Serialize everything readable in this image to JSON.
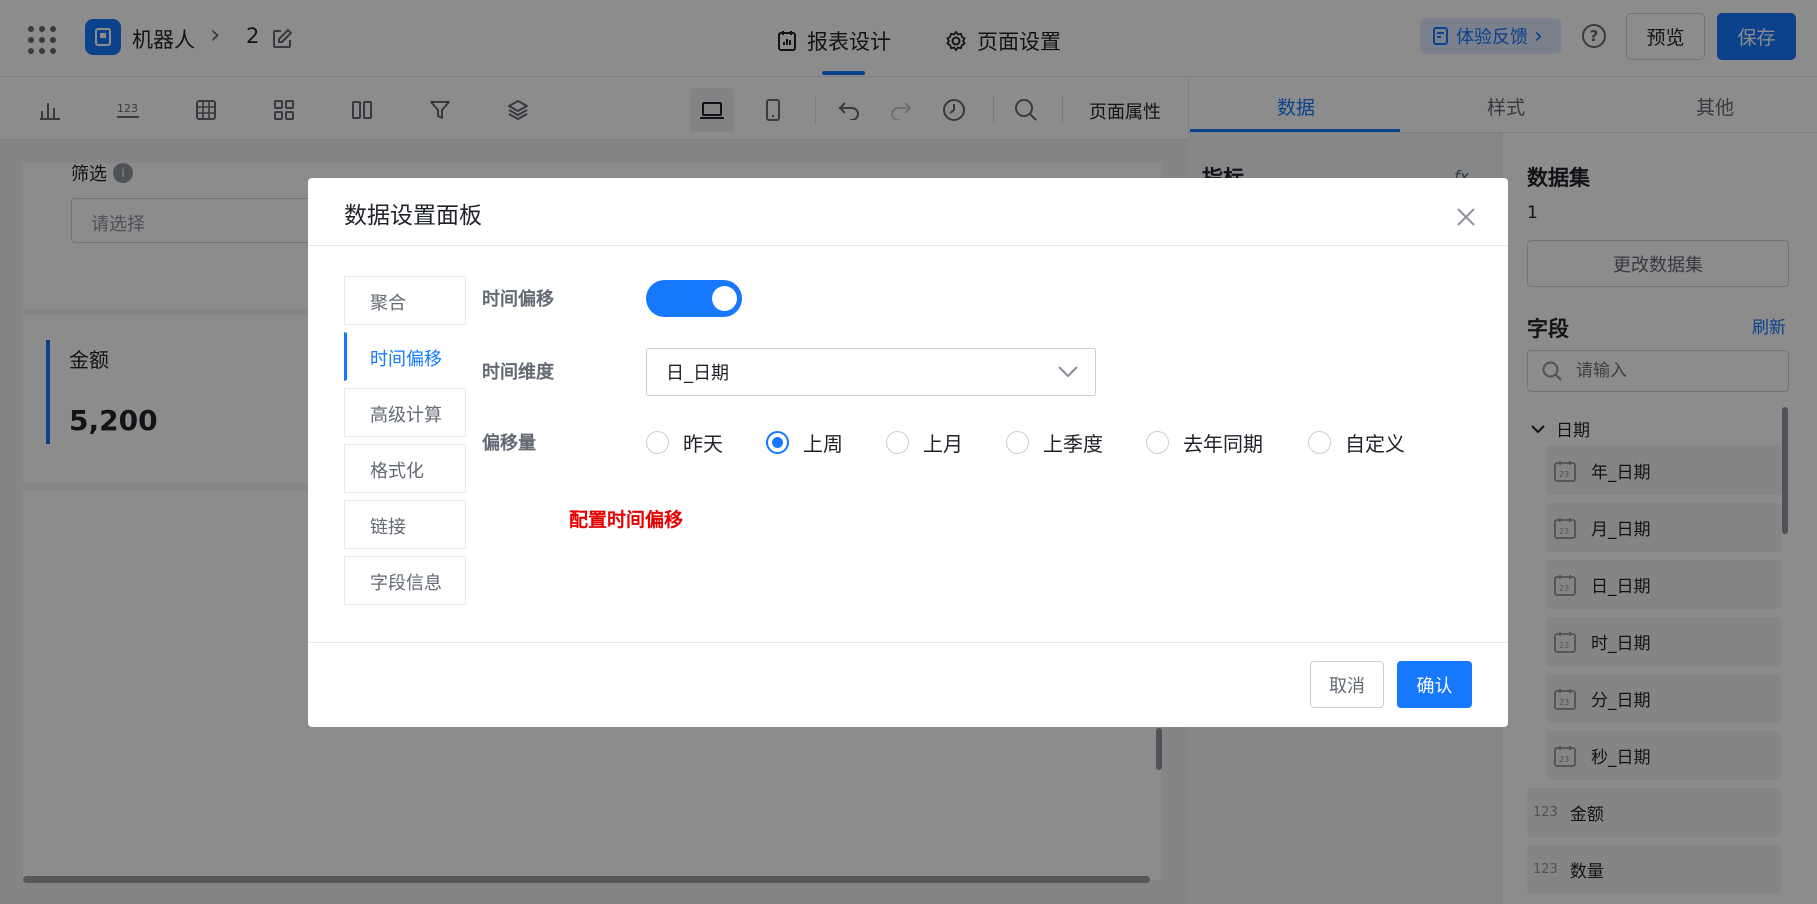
{
  "header": {
    "app_name": "机器人",
    "sep": "›",
    "doc_name": "2",
    "tabs": [
      {
        "label": "报表设计"
      },
      {
        "label": "页面设置"
      }
    ],
    "feedback": "体验反馈",
    "feedback_chevron": "›",
    "help_glyph": "?",
    "preview": "预览",
    "save": "保存"
  },
  "toolbar": {
    "page_props": "页面属性"
  },
  "canvas": {
    "filter_label": "筛选",
    "info_glyph": "i",
    "filter_placeholder": "请选择",
    "metric_title": "金额",
    "metric_value": "5,200"
  },
  "right_panel": {
    "tabs": [
      {
        "label": "数据"
      },
      {
        "label": "样式"
      },
      {
        "label": "其他"
      }
    ],
    "metric_title": "指标",
    "fx_glyph": "fx",
    "dataset_title": "数据集",
    "dataset_name": "1",
    "change_dataset": "更改数据集",
    "fields_title": "字段",
    "refresh": "刷新",
    "search_placeholder": "请输入",
    "group_label": "日期",
    "date_fields": [
      "年_日期",
      "月_日期",
      "日_日期",
      "时_日期",
      "分_日期",
      "秒_日期"
    ],
    "num_glyph": "123",
    "num_fields": [
      "金额",
      "数量"
    ]
  },
  "modal": {
    "title": "数据设置面板",
    "side_tabs": [
      "聚合",
      "时间偏移",
      "高级计算",
      "格式化",
      "链接",
      "字段信息"
    ],
    "label_offset": "时间偏移",
    "label_dimension": "时间维度",
    "label_amount": "偏移量",
    "dimension_value": "日_日期",
    "radios": [
      "昨天",
      "上周",
      "上月",
      "上季度",
      "去年同期",
      "自定义"
    ],
    "selected_radio": "上周",
    "note": "配置时间偏移",
    "cancel": "取消",
    "confirm": "确认"
  },
  "colors": {
    "primary": "#1677ff",
    "note_red": "#e60000"
  }
}
